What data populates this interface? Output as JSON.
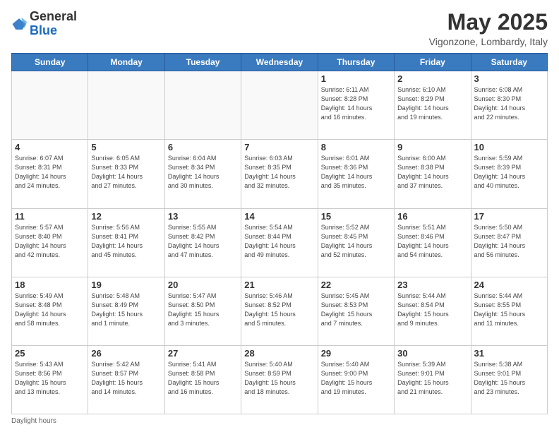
{
  "header": {
    "logo_general": "General",
    "logo_blue": "Blue",
    "month_title": "May 2025",
    "subtitle": "Vigonzone, Lombardy, Italy"
  },
  "weekdays": [
    "Sunday",
    "Monday",
    "Tuesday",
    "Wednesday",
    "Thursday",
    "Friday",
    "Saturday"
  ],
  "footer": {
    "daylight_label": "Daylight hours"
  },
  "weeks": [
    [
      {
        "day": "",
        "info": ""
      },
      {
        "day": "",
        "info": ""
      },
      {
        "day": "",
        "info": ""
      },
      {
        "day": "",
        "info": ""
      },
      {
        "day": "1",
        "info": "Sunrise: 6:11 AM\nSunset: 8:28 PM\nDaylight: 14 hours\nand 16 minutes."
      },
      {
        "day": "2",
        "info": "Sunrise: 6:10 AM\nSunset: 8:29 PM\nDaylight: 14 hours\nand 19 minutes."
      },
      {
        "day": "3",
        "info": "Sunrise: 6:08 AM\nSunset: 8:30 PM\nDaylight: 14 hours\nand 22 minutes."
      }
    ],
    [
      {
        "day": "4",
        "info": "Sunrise: 6:07 AM\nSunset: 8:31 PM\nDaylight: 14 hours\nand 24 minutes."
      },
      {
        "day": "5",
        "info": "Sunrise: 6:05 AM\nSunset: 8:33 PM\nDaylight: 14 hours\nand 27 minutes."
      },
      {
        "day": "6",
        "info": "Sunrise: 6:04 AM\nSunset: 8:34 PM\nDaylight: 14 hours\nand 30 minutes."
      },
      {
        "day": "7",
        "info": "Sunrise: 6:03 AM\nSunset: 8:35 PM\nDaylight: 14 hours\nand 32 minutes."
      },
      {
        "day": "8",
        "info": "Sunrise: 6:01 AM\nSunset: 8:36 PM\nDaylight: 14 hours\nand 35 minutes."
      },
      {
        "day": "9",
        "info": "Sunrise: 6:00 AM\nSunset: 8:38 PM\nDaylight: 14 hours\nand 37 minutes."
      },
      {
        "day": "10",
        "info": "Sunrise: 5:59 AM\nSunset: 8:39 PM\nDaylight: 14 hours\nand 40 minutes."
      }
    ],
    [
      {
        "day": "11",
        "info": "Sunrise: 5:57 AM\nSunset: 8:40 PM\nDaylight: 14 hours\nand 42 minutes."
      },
      {
        "day": "12",
        "info": "Sunrise: 5:56 AM\nSunset: 8:41 PM\nDaylight: 14 hours\nand 45 minutes."
      },
      {
        "day": "13",
        "info": "Sunrise: 5:55 AM\nSunset: 8:42 PM\nDaylight: 14 hours\nand 47 minutes."
      },
      {
        "day": "14",
        "info": "Sunrise: 5:54 AM\nSunset: 8:44 PM\nDaylight: 14 hours\nand 49 minutes."
      },
      {
        "day": "15",
        "info": "Sunrise: 5:52 AM\nSunset: 8:45 PM\nDaylight: 14 hours\nand 52 minutes."
      },
      {
        "day": "16",
        "info": "Sunrise: 5:51 AM\nSunset: 8:46 PM\nDaylight: 14 hours\nand 54 minutes."
      },
      {
        "day": "17",
        "info": "Sunrise: 5:50 AM\nSunset: 8:47 PM\nDaylight: 14 hours\nand 56 minutes."
      }
    ],
    [
      {
        "day": "18",
        "info": "Sunrise: 5:49 AM\nSunset: 8:48 PM\nDaylight: 14 hours\nand 58 minutes."
      },
      {
        "day": "19",
        "info": "Sunrise: 5:48 AM\nSunset: 8:49 PM\nDaylight: 15 hours\nand 1 minute."
      },
      {
        "day": "20",
        "info": "Sunrise: 5:47 AM\nSunset: 8:50 PM\nDaylight: 15 hours\nand 3 minutes."
      },
      {
        "day": "21",
        "info": "Sunrise: 5:46 AM\nSunset: 8:52 PM\nDaylight: 15 hours\nand 5 minutes."
      },
      {
        "day": "22",
        "info": "Sunrise: 5:45 AM\nSunset: 8:53 PM\nDaylight: 15 hours\nand 7 minutes."
      },
      {
        "day": "23",
        "info": "Sunrise: 5:44 AM\nSunset: 8:54 PM\nDaylight: 15 hours\nand 9 minutes."
      },
      {
        "day": "24",
        "info": "Sunrise: 5:44 AM\nSunset: 8:55 PM\nDaylight: 15 hours\nand 11 minutes."
      }
    ],
    [
      {
        "day": "25",
        "info": "Sunrise: 5:43 AM\nSunset: 8:56 PM\nDaylight: 15 hours\nand 13 minutes."
      },
      {
        "day": "26",
        "info": "Sunrise: 5:42 AM\nSunset: 8:57 PM\nDaylight: 15 hours\nand 14 minutes."
      },
      {
        "day": "27",
        "info": "Sunrise: 5:41 AM\nSunset: 8:58 PM\nDaylight: 15 hours\nand 16 minutes."
      },
      {
        "day": "28",
        "info": "Sunrise: 5:40 AM\nSunset: 8:59 PM\nDaylight: 15 hours\nand 18 minutes."
      },
      {
        "day": "29",
        "info": "Sunrise: 5:40 AM\nSunset: 9:00 PM\nDaylight: 15 hours\nand 19 minutes."
      },
      {
        "day": "30",
        "info": "Sunrise: 5:39 AM\nSunset: 9:01 PM\nDaylight: 15 hours\nand 21 minutes."
      },
      {
        "day": "31",
        "info": "Sunrise: 5:38 AM\nSunset: 9:01 PM\nDaylight: 15 hours\nand 23 minutes."
      }
    ]
  ]
}
